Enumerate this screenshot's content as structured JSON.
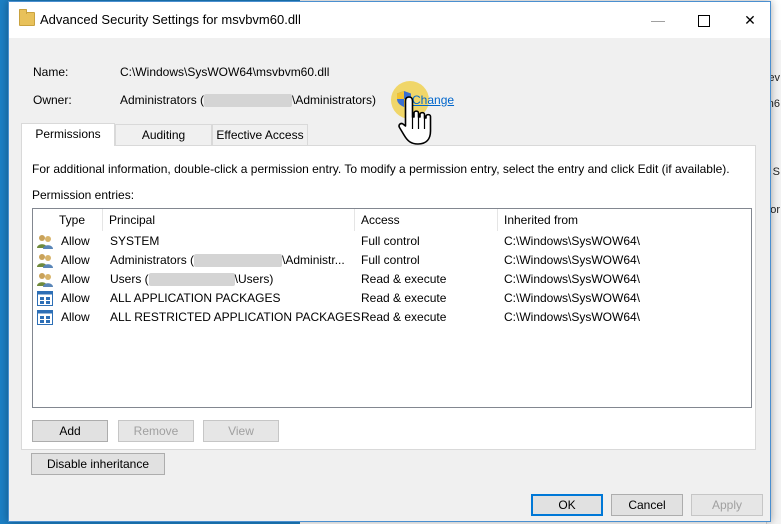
{
  "background": {
    "rtext1": "ev",
    "rtext2": "n6",
    "rtext3": "S",
    "rtext4": "or"
  },
  "window": {
    "title": "Advanced Security Settings for msvbvm60.dll",
    "minimize_glyph": "—",
    "close_glyph": "✕"
  },
  "name_row": {
    "label": "Name:",
    "value": "C:\\Windows\\SysWOW64\\msvbvm60.dll"
  },
  "owner_row": {
    "label": "Owner:",
    "value_prefix": "Administrators (",
    "value_suffix": "\\Administrators)",
    "change_label": "Change"
  },
  "tabs": [
    {
      "label": "Permissions",
      "active": true
    },
    {
      "label": "Auditing",
      "active": false
    },
    {
      "label": "Effective Access",
      "active": false
    }
  ],
  "permissions": {
    "info_text": "For additional information, double-click a permission entry. To modify a permission entry, select the entry and click Edit (if available).",
    "entries_label": "Permission entries:",
    "columns": {
      "type": "Type",
      "principal": "Principal",
      "access": "Access",
      "inherited": "Inherited from"
    },
    "rows": [
      {
        "icon": "user-group-icon",
        "type": "Allow",
        "principal": "SYSTEM",
        "access": "Full control",
        "inherited": "C:\\Windows\\SysWOW64\\"
      },
      {
        "icon": "user-group-icon",
        "type": "Allow",
        "principal_prefix": "Administrators (",
        "principal_suffix": "\\Administr...",
        "access": "Full control",
        "inherited": "C:\\Windows\\SysWOW64\\"
      },
      {
        "icon": "user-group-icon",
        "type": "Allow",
        "principal_prefix": "Users (",
        "principal_suffix": "\\Users)",
        "access": "Read & execute",
        "inherited": "C:\\Windows\\SysWOW64\\"
      },
      {
        "icon": "app-package-icon",
        "type": "Allow",
        "principal": "ALL APPLICATION PACKAGES",
        "access": "Read & execute",
        "inherited": "C:\\Windows\\SysWOW64\\"
      },
      {
        "icon": "app-package-icon",
        "type": "Allow",
        "principal": "ALL RESTRICTED APPLICATION PACKAGES",
        "access": "Read & execute",
        "inherited": "C:\\Windows\\SysWOW64\\"
      }
    ],
    "add_label": "Add",
    "remove_label": "Remove",
    "view_label": "View",
    "disable_inheritance_label": "Disable inheritance"
  },
  "footer": {
    "ok_label": "OK",
    "cancel_label": "Cancel",
    "apply_label": "Apply"
  },
  "colors": {
    "accent": "#0078d7",
    "link": "#0066cc",
    "desktop": "#1c7fc4",
    "dialog_bg": "#f0f0f0"
  }
}
